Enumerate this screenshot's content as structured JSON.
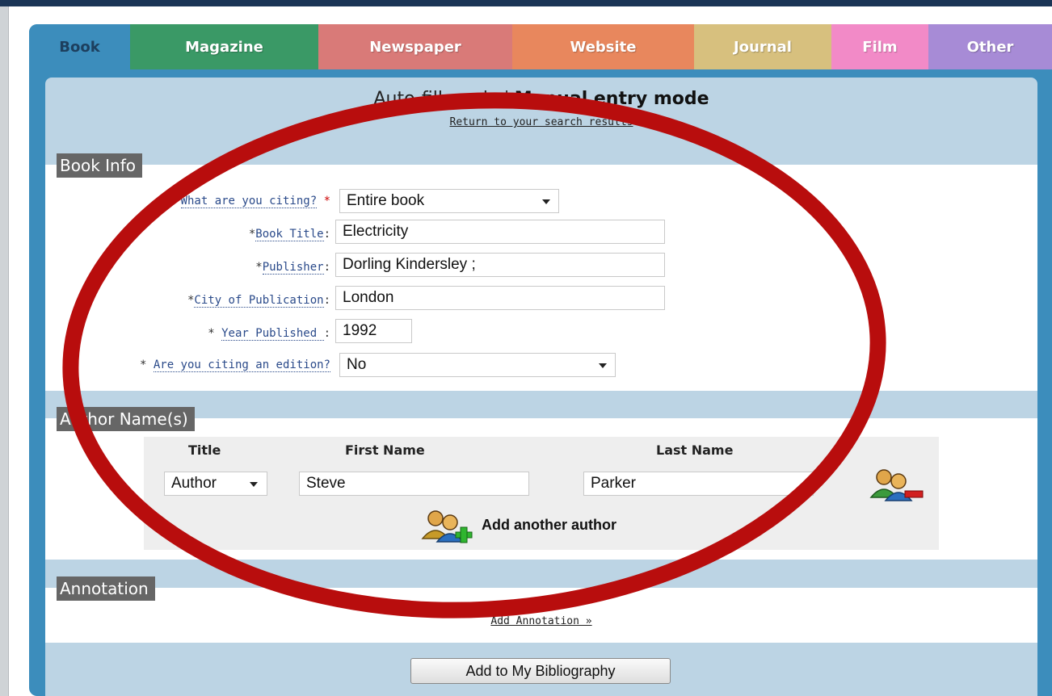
{
  "tabs": [
    {
      "label": "Book",
      "color": "#3c8dbc"
    },
    {
      "label": "Magazine",
      "color": "#3a9966"
    },
    {
      "label": "Newspaper",
      "color": "#d97a78"
    },
    {
      "label": "Website",
      "color": "#e8875d"
    },
    {
      "label": "Journal",
      "color": "#d7c07e"
    },
    {
      "label": "Film",
      "color": "#f28ac7"
    },
    {
      "label": "Other",
      "color": "#a78bd6"
    }
  ],
  "mode": {
    "auto_label": "Auto-fill mode",
    "separator": "|",
    "manual_label": "Manual entry mode",
    "return_link": "Return to your search results"
  },
  "book_info": {
    "heading": "Book Info",
    "citing": {
      "label": "What are you citing?",
      "required_mark": "*",
      "value": "Entire book"
    },
    "title": {
      "prefix": "*",
      "label": "Book Title",
      "colon": ":",
      "value": "Electricity"
    },
    "publisher": {
      "prefix": "*",
      "label": "Publisher",
      "colon": ":",
      "value": "Dorling Kindersley ;"
    },
    "city": {
      "prefix": "*",
      "label": "City of Publication",
      "colon": ":",
      "value": "London"
    },
    "year": {
      "prefix": "* ",
      "label": "Year Published ",
      "colon": ":",
      "value": "1992"
    },
    "edition": {
      "prefix": "* ",
      "label": "Are you citing an edition?",
      "value": "No"
    }
  },
  "authors": {
    "heading": "Author Name(s)",
    "col_title": "Title",
    "col_first": "First Name",
    "col_last": "Last Name",
    "row": {
      "title": "Author",
      "first": "Steve",
      "last": "Parker"
    },
    "add_label": "Add another author"
  },
  "annotation": {
    "heading": "Annotation",
    "link": "Add Annotation »"
  },
  "submit": {
    "label": "Add to My Bibliography"
  },
  "colors": {
    "frame": "#3c8dbc",
    "panel": "#bcd4e4",
    "heading_bg": "#666666",
    "ring": "#b80d0d"
  },
  "icons": {
    "remove_author": "people-remove-icon",
    "add_author": "people-add-icon"
  }
}
